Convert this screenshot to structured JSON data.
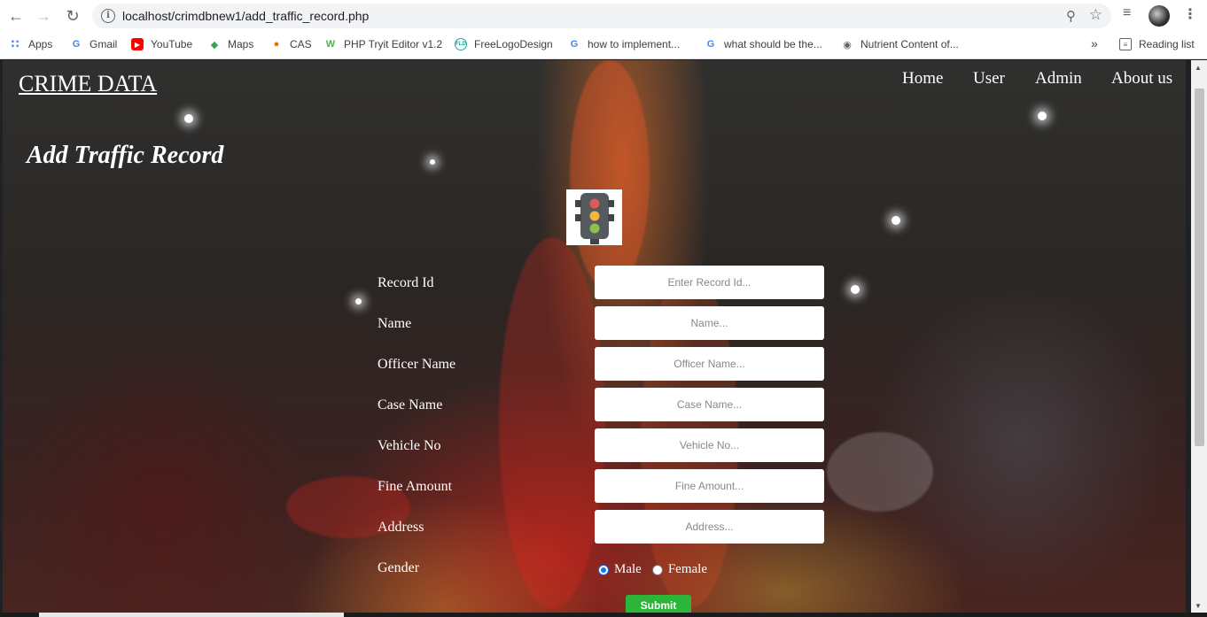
{
  "browser": {
    "url": "localhost/crimdbnew1/add_traffic_record.php",
    "bookmarks": [
      {
        "label": "Apps",
        "icon": "apps-grid-icon"
      },
      {
        "label": "Gmail",
        "icon": "google-icon"
      },
      {
        "label": "YouTube",
        "icon": "youtube-icon"
      },
      {
        "label": "Maps",
        "icon": "maps-icon"
      },
      {
        "label": "CAS",
        "icon": "cas-icon"
      },
      {
        "label": "PHP Tryit Editor v1.2",
        "icon": "w3schools-icon"
      },
      {
        "label": "FreeLogoDesign",
        "icon": "freelogodesign-icon"
      },
      {
        "label": "how to implement...",
        "icon": "google-icon"
      },
      {
        "label": "what should be the...",
        "icon": "google-icon"
      },
      {
        "label": "Nutrient Content of...",
        "icon": "globe-icon"
      }
    ],
    "more_label": "»",
    "reading_list": "Reading list"
  },
  "site": {
    "title": "CRIME DATA",
    "nav": [
      "Home",
      "User",
      "Admin",
      "About us"
    ]
  },
  "form": {
    "title": "Add Traffic Record",
    "fields": [
      {
        "label": "Record Id",
        "placeholder": "Enter Record Id..."
      },
      {
        "label": "Name",
        "placeholder": "Name..."
      },
      {
        "label": "Officer Name",
        "placeholder": "Officer Name..."
      },
      {
        "label": "Case Name",
        "placeholder": "Case Name..."
      },
      {
        "label": "Vehicle No",
        "placeholder": "Vehicle No..."
      },
      {
        "label": "Fine Amount",
        "placeholder": "Fine Amount..."
      },
      {
        "label": "Address",
        "placeholder": "Address..."
      }
    ],
    "gender_label": "Gender",
    "gender_options": [
      "Male",
      "Female"
    ],
    "gender_selected": "Male",
    "submit_label": "Submit"
  }
}
